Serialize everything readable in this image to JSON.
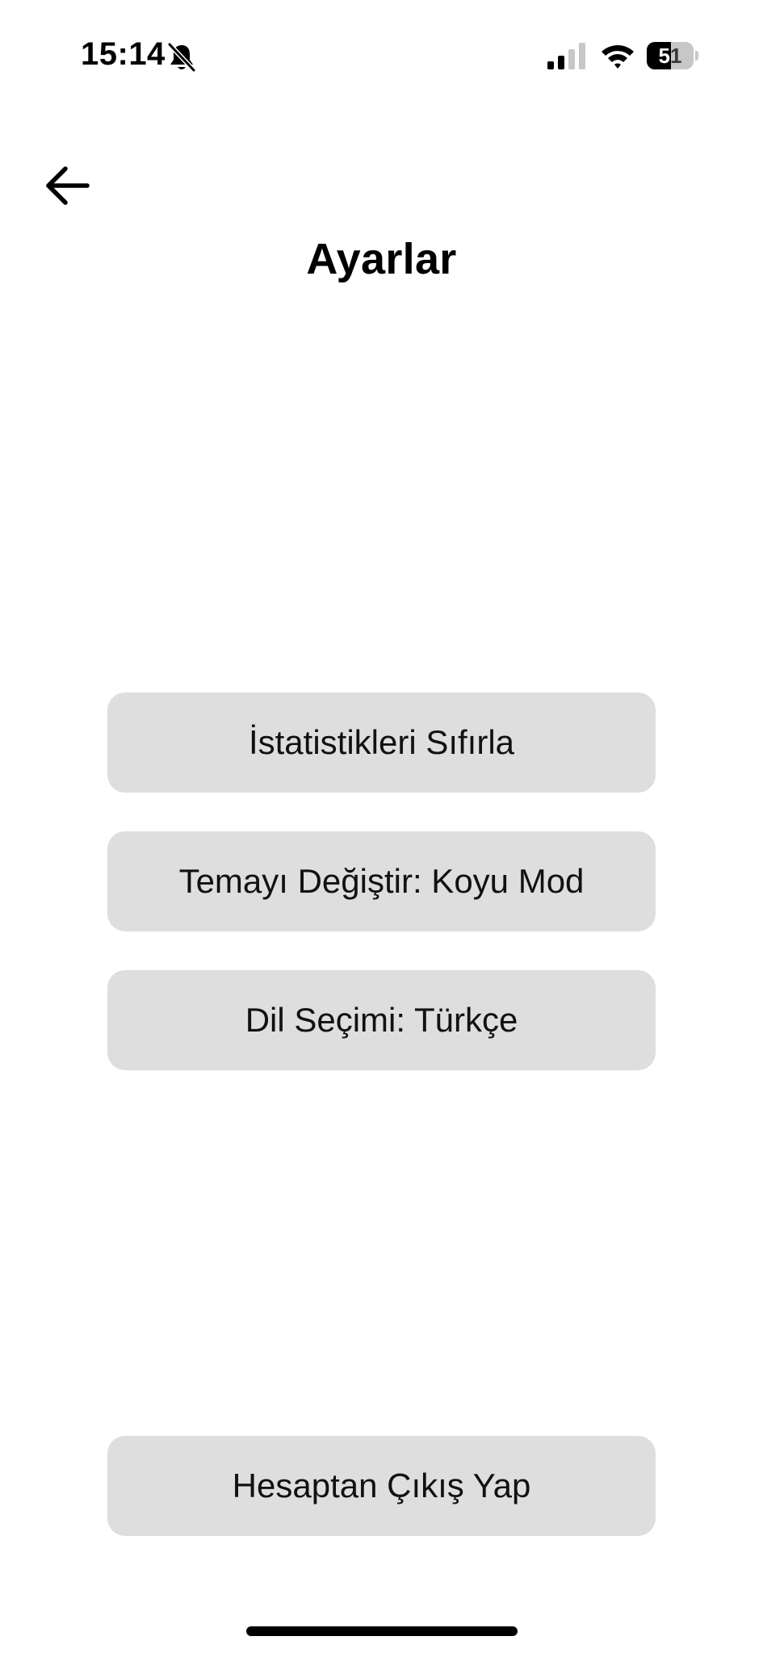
{
  "status_bar": {
    "time": "15:14",
    "battery_level": 51,
    "battery_label": "51",
    "icons": [
      "bell-slash-icon",
      "cellular-signal-icon",
      "wifi-icon",
      "battery-icon"
    ],
    "signal_bars_active": 2,
    "signal_bars_total": 4
  },
  "header": {
    "back_icon": "arrow-left-icon",
    "title": "Ayarlar"
  },
  "settings": {
    "reset_stats_label": "İstatistikleri Sıfırla",
    "theme_label": "Temayı Değiştir: Koyu Mod",
    "language_label": "Dil Seçimi: Türkçe"
  },
  "account": {
    "logout_label": "Hesaptan Çıkış Yap"
  },
  "colors": {
    "background": "#ffffff",
    "button_background": "#dedede",
    "text": "#000000"
  }
}
